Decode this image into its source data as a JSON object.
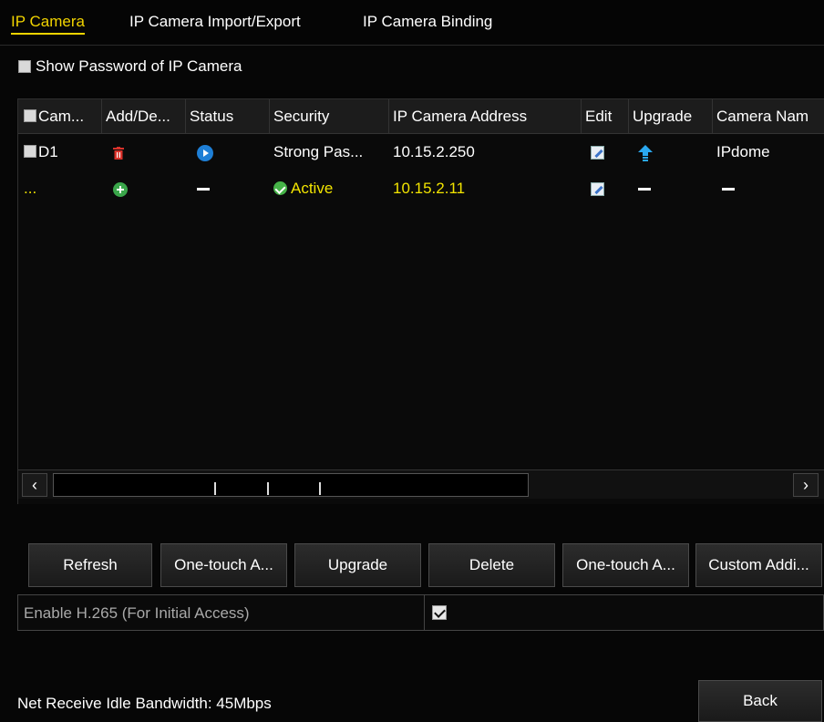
{
  "tabs": [
    {
      "label": "IP Camera",
      "active": true
    },
    {
      "label": "IP Camera Import/Export",
      "active": false
    },
    {
      "label": "IP Camera Binding",
      "active": false
    }
  ],
  "show_password": {
    "label": "Show Password of IP Camera",
    "checked": false
  },
  "table": {
    "headers": [
      "Cam...",
      "Add/De...",
      "Status",
      "Security",
      "IP Camera Address",
      "Edit",
      "Upgrade",
      "Camera Nam"
    ],
    "rows": [
      {
        "camera": "D1",
        "security": "Strong Pas...",
        "ip": "10.15.2.250",
        "name": "IPdome"
      },
      {
        "camera": "...",
        "security": "Active",
        "ip": "10.15.2.11",
        "name": ""
      }
    ]
  },
  "buttons": {
    "refresh": "Refresh",
    "one_touch_activate": "One-touch A...",
    "upgrade": "Upgrade",
    "delete": "Delete",
    "one_touch_adding": "One-touch A...",
    "custom_adding": "Custom Addi..."
  },
  "h265": {
    "label": "Enable H.265 (For Initial Access)",
    "checked": true
  },
  "bandwidth": "Net Receive Idle Bandwidth: 45Mbps",
  "back": "Back",
  "colors": {
    "accent": "#f2d400",
    "active_text": "#f2e400",
    "status_blue": "#1e7fd6",
    "delete_red": "#d9322b",
    "ok_green": "#3aa64a"
  }
}
